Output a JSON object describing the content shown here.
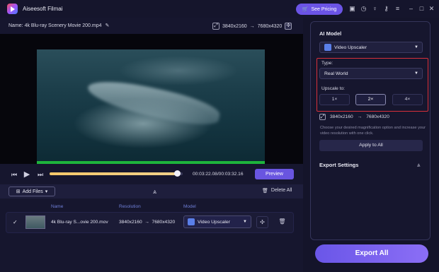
{
  "app": {
    "title": "Aiseesoft Filmai",
    "pricing_label": "See Pricing"
  },
  "titlebar_icons": [
    "gallery-icon",
    "clock-icon",
    "bulb-icon",
    "key-icon",
    "menu-icon",
    "minimize-icon",
    "maximize-icon",
    "close-icon"
  ],
  "file_info": {
    "name_label": "Name:",
    "name": "4k Blu-ray Scenery Movie 200.mp4",
    "src_res": "3840x2160",
    "arrow": "→",
    "dst_res": "7680x4320"
  },
  "player": {
    "timecode": "00:03:22.08/00:03:32.16",
    "progress": 0.96,
    "preview_label": "Preview"
  },
  "files_bar": {
    "add_label": "Add Files",
    "delete_all_label": "Delete All"
  },
  "table": {
    "headers": {
      "name": "Name",
      "resolution": "Resolution",
      "model": "Model"
    },
    "rows": [
      {
        "name": "4k Blu-ray S...ovie 200.mov",
        "resolution": "3840x2160  →  7680x4320",
        "model": "Video Upscaler"
      }
    ]
  },
  "right_panel": {
    "ai_model_title": "AI Model",
    "model_value": "Video Upscaler",
    "type_label": "Type:",
    "type_value": "Real World",
    "upscale_label": "Upscale to:",
    "scales": [
      "1×",
      "2×",
      "4×"
    ],
    "active_scale": "2×",
    "out_src": "3840x2160",
    "out_arrow": "→",
    "out_dst": "7680x4320",
    "hint": "Choose your desired magnification option and increase your video resolution with one click.",
    "apply_label": "Apply to All",
    "export_settings_title": "Export Settings",
    "export_all_label": "Export All"
  },
  "colors": {
    "accent": "#6b54e6",
    "highlight_box": "#d8303a",
    "progress_green": "#1eb43c",
    "header_text": "#6f7fd8"
  }
}
